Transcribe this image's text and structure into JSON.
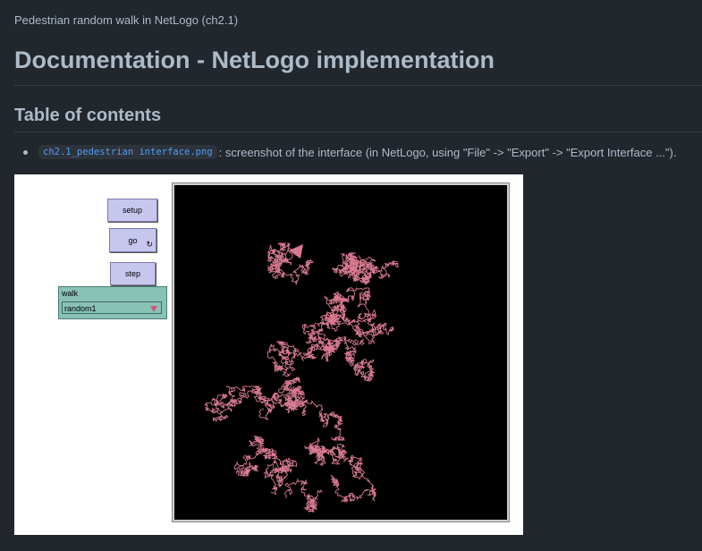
{
  "breadcrumb": "Pedestrian random walk in NetLogo (ch2.1)",
  "title": "Documentation - NetLogo implementation",
  "toc_heading": "Table of contents",
  "toc_items": [
    {
      "code": "ch2.1_pedestrian interface.png",
      "text": ": screenshot of the interface (in NetLogo, using \"File\" -> \"Export\" -> \"Export Interface ...\")."
    }
  ],
  "netlogo": {
    "setup_label": "setup",
    "go_label": "go",
    "forever_icon": "forever-loop-icon",
    "step_label": "step",
    "chooser_label": "walk",
    "chooser_value": "random1",
    "trail_color": "#d97a91",
    "view_background": "#000000"
  }
}
